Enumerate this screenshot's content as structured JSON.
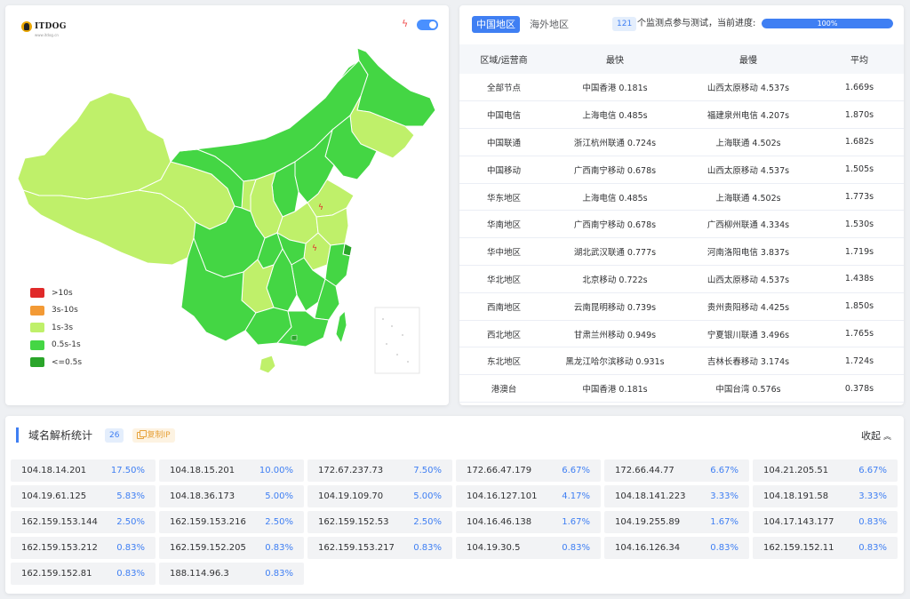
{
  "logo": {
    "text": "ITDOG",
    "subtext": "www.itdog.cn"
  },
  "colors": {
    "accent": "#3f7ff3",
    "over10": "#e02a2a",
    "s3to10": "#f39a35",
    "s1to3": "#bff06a",
    "s05to1": "#44d644",
    "under05": "#2aa52a"
  },
  "map": {
    "legend": [
      {
        "label": ">10s",
        "color": "#e02a2a"
      },
      {
        "label": "3s-10s",
        "color": "#f39a35"
      },
      {
        "label": "1s-3s",
        "color": "#bff06a"
      },
      {
        "label": "0.5s-1s",
        "color": "#44d644"
      },
      {
        "label": "<=0.5s",
        "color": "#2aa52a"
      }
    ]
  },
  "tabs": [
    {
      "label": "中国地区",
      "active": true
    },
    {
      "label": "海外地区",
      "active": false
    }
  ],
  "progress": {
    "count": "121",
    "text": "个监测点参与测试，当前进度:",
    "value": 100,
    "label": "100%"
  },
  "stats_table": {
    "headers": [
      "区域/运营商",
      "最快",
      "最慢",
      "平均"
    ],
    "rows": [
      [
        "全部节点",
        "中国香港 0.181s",
        "山西太原移动 4.537s",
        "1.669s"
      ],
      [
        "中国电信",
        "上海电信 0.485s",
        "福建泉州电信 4.207s",
        "1.870s"
      ],
      [
        "中国联通",
        "浙江杭州联通 0.724s",
        "上海联通 4.502s",
        "1.682s"
      ],
      [
        "中国移动",
        "广西南宁移动 0.678s",
        "山西太原移动 4.537s",
        "1.505s"
      ],
      [
        "华东地区",
        "上海电信 0.485s",
        "上海联通 4.502s",
        "1.773s"
      ],
      [
        "华南地区",
        "广西南宁移动 0.678s",
        "广西柳州联通 4.334s",
        "1.530s"
      ],
      [
        "华中地区",
        "湖北武汉联通 0.777s",
        "河南洛阳电信 3.837s",
        "1.719s"
      ],
      [
        "华北地区",
        "北京移动 0.722s",
        "山西太原移动 4.537s",
        "1.438s"
      ],
      [
        "西南地区",
        "云南昆明移动 0.739s",
        "贵州贵阳移动 4.425s",
        "1.850s"
      ],
      [
        "西北地区",
        "甘肃兰州移动 0.949s",
        "宁夏银川联通 3.496s",
        "1.765s"
      ],
      [
        "东北地区",
        "黑龙江哈尔滨移动 0.931s",
        "吉林长春移动 3.174s",
        "1.724s"
      ],
      [
        "港澳台",
        "中国香港 0.181s",
        "中国台湾 0.576s",
        "0.378s"
      ]
    ]
  },
  "dns": {
    "title": "域名解析统计",
    "count": "26",
    "copy_label": "复制IP",
    "collapse_label": "收起",
    "ips": [
      {
        "ip": "104.18.14.201",
        "pct": "17.50%"
      },
      {
        "ip": "104.18.15.201",
        "pct": "10.00%"
      },
      {
        "ip": "172.67.237.73",
        "pct": "7.50%"
      },
      {
        "ip": "172.66.47.179",
        "pct": "6.67%"
      },
      {
        "ip": "172.66.44.77",
        "pct": "6.67%"
      },
      {
        "ip": "104.21.205.51",
        "pct": "6.67%"
      },
      {
        "ip": "104.19.61.125",
        "pct": "5.83%"
      },
      {
        "ip": "104.18.36.173",
        "pct": "5.00%"
      },
      {
        "ip": "104.19.109.70",
        "pct": "5.00%"
      },
      {
        "ip": "104.16.127.101",
        "pct": "4.17%"
      },
      {
        "ip": "104.18.141.223",
        "pct": "3.33%"
      },
      {
        "ip": "104.18.191.58",
        "pct": "3.33%"
      },
      {
        "ip": "162.159.153.144",
        "pct": "2.50%"
      },
      {
        "ip": "162.159.153.216",
        "pct": "2.50%"
      },
      {
        "ip": "162.159.152.53",
        "pct": "2.50%"
      },
      {
        "ip": "104.16.46.138",
        "pct": "1.67%"
      },
      {
        "ip": "104.19.255.89",
        "pct": "1.67%"
      },
      {
        "ip": "104.17.143.177",
        "pct": "0.83%"
      },
      {
        "ip": "162.159.153.212",
        "pct": "0.83%"
      },
      {
        "ip": "162.159.152.205",
        "pct": "0.83%"
      },
      {
        "ip": "162.159.153.217",
        "pct": "0.83%"
      },
      {
        "ip": "104.19.30.5",
        "pct": "0.83%"
      },
      {
        "ip": "104.16.126.34",
        "pct": "0.83%"
      },
      {
        "ip": "162.159.152.11",
        "pct": "0.83%"
      },
      {
        "ip": "162.159.152.81",
        "pct": "0.83%"
      },
      {
        "ip": "188.114.96.3",
        "pct": "0.83%"
      }
    ]
  }
}
